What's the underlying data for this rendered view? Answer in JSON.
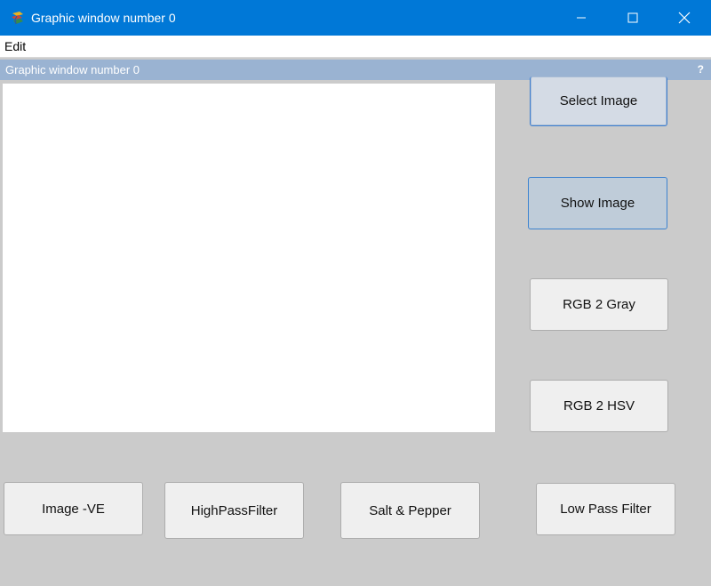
{
  "window": {
    "title": "Graphic window number 0",
    "controls": {
      "minimize_icon": "minimize-icon",
      "maximize_icon": "maximize-icon",
      "close_icon": "close-icon"
    },
    "titlebar_color": "#0078d7"
  },
  "menubar": {
    "items": [
      {
        "label": "Edit"
      }
    ]
  },
  "dock": {
    "title": "Graphic window number 0",
    "help_label": "?",
    "color": "#9ab3d2"
  },
  "buttons": {
    "select_image": "Select Image",
    "show_image": "Show Image",
    "rgb2gray": "RGB 2 Gray",
    "rgb2hsv": "RGB 2 HSV",
    "image_negative": "Image -VE",
    "high_pass": "HighPassFilter",
    "salt_pepper": "Salt & Pepper",
    "low_pass": "Low Pass Filter"
  },
  "colors": {
    "background": "#cbcbcb",
    "canvas": "#ffffff",
    "button": "#efefef",
    "focus_border": "#3c82cf"
  }
}
